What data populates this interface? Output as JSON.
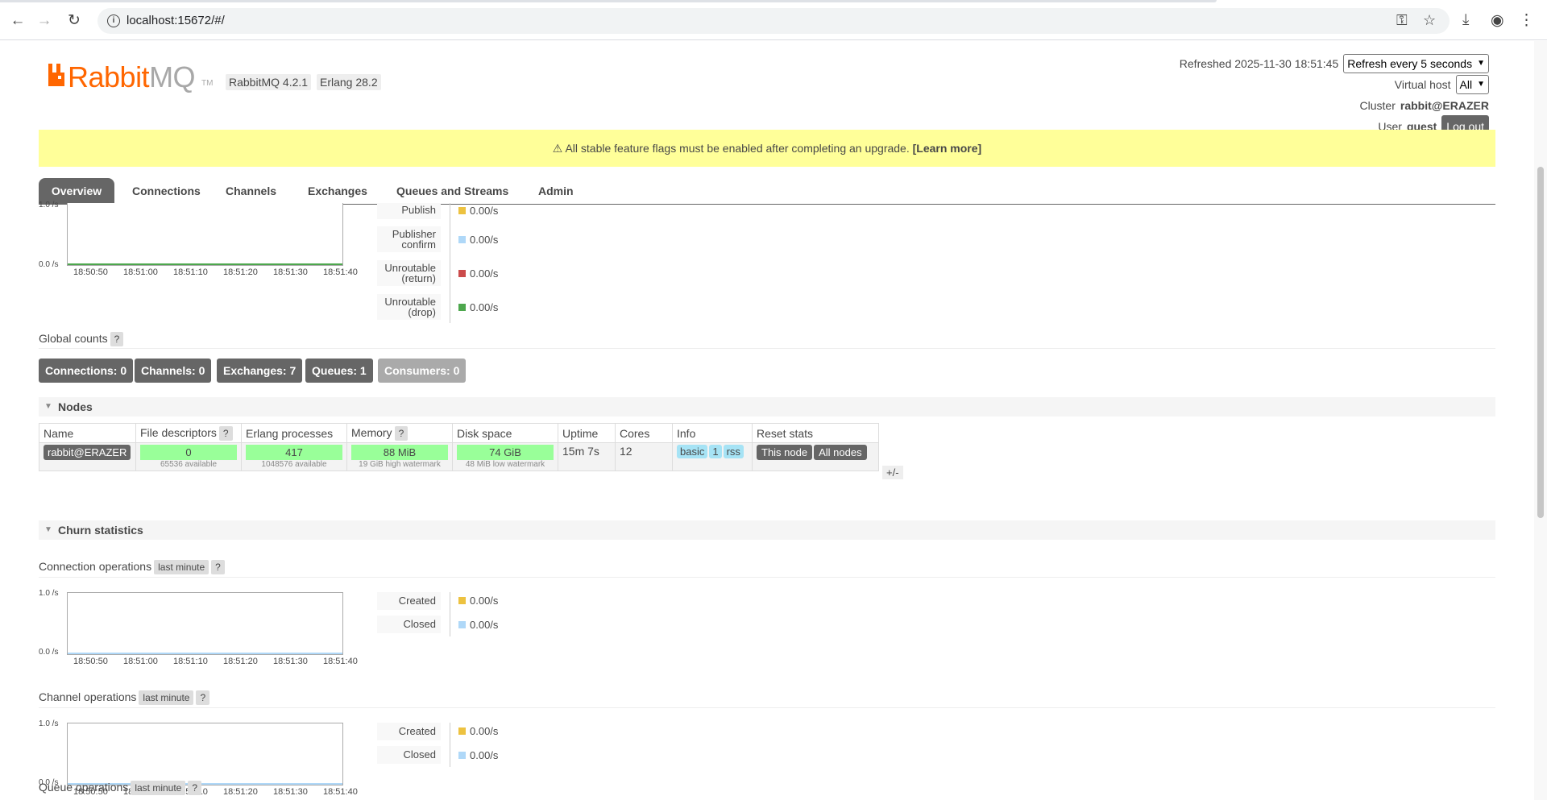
{
  "browser": {
    "url": "localhost:15672/#/"
  },
  "header": {
    "logo_rabbit": "Rabbit",
    "logo_mq": "MQ",
    "logo_tm": "TM",
    "rabbitmq_version": "RabbitMQ 4.2.1",
    "erlang_version": "Erlang 28.2",
    "refreshed_label": "Refreshed 2025-11-30 18:51:45",
    "refresh_select": "Refresh every 5 seconds",
    "virtual_host_label": "Virtual host",
    "virtual_host_value": "All",
    "cluster_label": "Cluster",
    "cluster_value": "rabbit@ERAZER",
    "user_label": "User",
    "user_value": "guest",
    "logout_label": "Log out"
  },
  "banner": {
    "text": "⚠ All stable feature flags must be enabled after completing an upgrade.",
    "link": "[Learn more]"
  },
  "tabs": [
    "Overview",
    "Connections",
    "Channels",
    "Exchanges",
    "Queues and Streams",
    "Admin"
  ],
  "message_rates": {
    "y_top": "1.0 /s",
    "y_bottom": "0.0 /s",
    "x_ticks": [
      "18:50:50",
      "18:51:00",
      "18:51:10",
      "18:51:20",
      "18:51:30",
      "18:51:40"
    ],
    "legend": [
      {
        "label": "Publish",
        "value": "0.00/s",
        "color": "#edc240"
      },
      {
        "label": "Publisher confirm",
        "value": "0.00/s",
        "color": "#afd8f8"
      },
      {
        "label": "Unroutable (return)",
        "value": "0.00/s",
        "color": "#cb4b4b"
      },
      {
        "label": "Unroutable (drop)",
        "value": "0.00/s",
        "color": "#4da74d"
      }
    ]
  },
  "global_counts": {
    "label": "Global counts",
    "help": "?",
    "connections": "Connections: 0",
    "channels": "Channels: 0",
    "exchanges": "Exchanges: 7",
    "queues": "Queues: 1",
    "consumers": "Consumers: 0"
  },
  "nodes": {
    "title": "Nodes",
    "headers": [
      "Name",
      "File descriptors",
      "Erlang processes",
      "Memory",
      "Disk space",
      "Uptime",
      "Cores",
      "Info",
      "Reset stats"
    ],
    "help": "?",
    "row": {
      "name": "rabbit@ERAZER",
      "fd": "0",
      "fd_sub": "65536 available",
      "erl": "417",
      "erl_sub": "1048576 available",
      "mem": "88 MiB",
      "mem_sub": "19 GiB high watermark",
      "disk": "74 GiB",
      "disk_sub": "48 MiB low watermark",
      "uptime": "15m 7s",
      "cores": "12",
      "info": [
        "basic",
        "1",
        "rss"
      ],
      "reset_this": "This node",
      "reset_all": "All nodes"
    },
    "plus_minus": "+/-"
  },
  "churn": {
    "title": "Churn statistics",
    "connection_ops": {
      "label": "Connection operations",
      "period": "last minute",
      "help": "?",
      "legend": [
        {
          "label": "Created",
          "value": "0.00/s",
          "color": "#edc240"
        },
        {
          "label": "Closed",
          "value": "0.00/s",
          "color": "#afd8f8"
        }
      ]
    },
    "channel_ops": {
      "label": "Channel operations",
      "period": "last minute",
      "help": "?",
      "legend": [
        {
          "label": "Created",
          "value": "0.00/s",
          "color": "#edc240"
        },
        {
          "label": "Closed",
          "value": "0.00/s",
          "color": "#afd8f8"
        }
      ]
    },
    "queue_ops": {
      "label": "Queue operations",
      "period": "last minute",
      "help": "?"
    },
    "y_top": "1.0 /s",
    "y_bottom": "0.0 /s",
    "x_ticks": [
      "18:50:50",
      "18:51:00",
      "18:51:10",
      "18:51:20",
      "18:51:30",
      "18:51:40"
    ]
  }
}
